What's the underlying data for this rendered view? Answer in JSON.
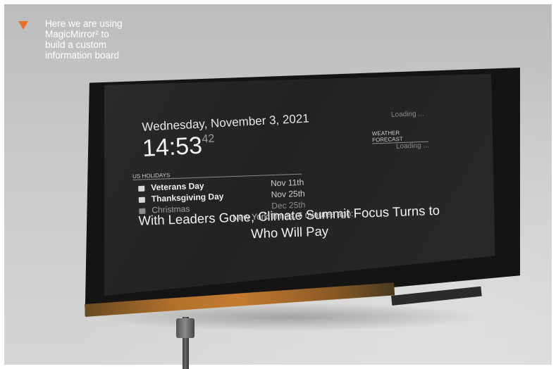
{
  "caption": {
    "text": "Here we are using\nMagicMirror² to\nbuild a custom\ninformation board",
    "accent_color": "#e8702a"
  },
  "screen": {
    "date": "Wednesday, November 3, 2021",
    "time_main": "14:53",
    "time_seconds": "42",
    "top_right_loading": "Loading ...",
    "weather": {
      "header": "WEATHER FORECAST",
      "status": "Loading ..."
    },
    "holidays": {
      "header": "US HOLIDAYS",
      "items": [
        {
          "icon": "calendar-icon",
          "name": "Veterans Day",
          "date": "Nov 11th"
        },
        {
          "icon": "calendar-icon",
          "name": "Thanksgiving Day",
          "date": "Nov 25th"
        },
        {
          "icon": "calendar-icon",
          "name": "Christmas",
          "date": "Dec 25th"
        }
      ]
    },
    "news": {
      "source": "New York Times, 6 minutes ago:",
      "headline": "With Leaders Gone, Climate Summit Focus Turns to Who Will Pay"
    }
  }
}
